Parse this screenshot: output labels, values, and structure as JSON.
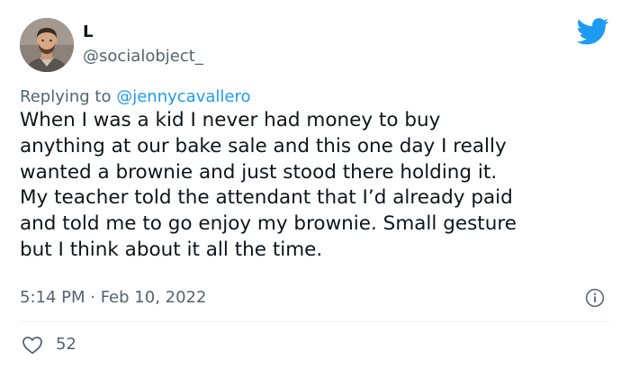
{
  "author": {
    "display_name": "L",
    "handle": "@socialobject_"
  },
  "reply": {
    "prefix": "Replying to",
    "mention": "@jennycavallero"
  },
  "tweet": {
    "lines": [
      "When I was a kid I never had money to buy",
      "anything at our bake sale and this one day I really",
      "wanted a brownie and just stood there holding it.",
      "My teacher told the attendant that I’d already paid",
      "and told me to go enjoy my brownie. Small gesture",
      "but I think about it all the time."
    ]
  },
  "meta": {
    "timestamp": "5:14 PM · Feb 10, 2022"
  },
  "actions": {
    "like_count": "52"
  },
  "icons": {
    "brand": "twitter-bird-icon",
    "info": "info-icon",
    "like": "heart-icon"
  },
  "colors": {
    "brand_blue": "#1d9bf0",
    "text_primary": "#0f1419",
    "text_secondary": "#536471"
  }
}
